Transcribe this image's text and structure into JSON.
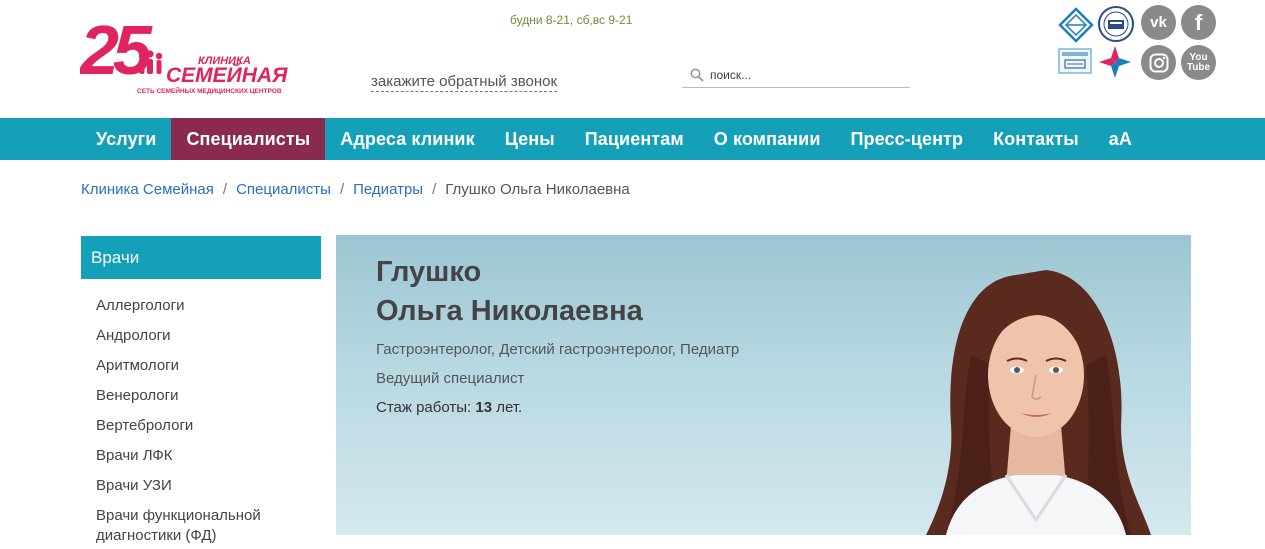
{
  "header": {
    "logo": {
      "number": "25",
      "line1": "КЛИНИКА",
      "line2": "СЕМЕЙНАЯ",
      "tagline": "СЕТЬ СЕМЕЙНЫХ МЕДИЦИНСКИХ ЦЕНТРОВ",
      "color": "#e0245e"
    },
    "hours": "будни 8-21, сб,вс 9-21",
    "callback": "закажите обратный звонок",
    "search": {
      "placeholder": "поиск..."
    },
    "badges": [
      "diamond-badge-icon",
      "seal-badge-icon",
      "certificate-icon",
      "arrows-logo-icon"
    ],
    "social": [
      "vk-icon",
      "facebook-icon",
      "instagram-icon",
      "youtube-icon"
    ],
    "social_text": {
      "vk": "vk",
      "facebook": "f",
      "youtube_top": "You",
      "youtube_bottom": "Tube"
    }
  },
  "nav": {
    "items": [
      "Услуги",
      "Специалисты",
      "Адреса клиник",
      "Цены",
      "Пациентам",
      "О компании",
      "Пресс-центр",
      "Контакты",
      "аА"
    ],
    "active": "Специалисты",
    "color": "#14a0b8",
    "active_color": "#8a2a4e"
  },
  "breadcrumb": {
    "items": [
      "Клиника Семейная",
      "Специалисты",
      "Педиатры"
    ],
    "current": "Глушко Ольга Николаевна",
    "sep": "/"
  },
  "sidebar": {
    "title": "Врачи",
    "items": [
      "Аллергологи",
      "Андрологи",
      "Аритмологи",
      "Венерологи",
      "Вертебрологи",
      "Врачи ЛФК",
      "Врачи УЗИ",
      "Врачи функциональной диагностики (ФД)"
    ]
  },
  "doctor": {
    "last_name": "Глушко",
    "first_names": "Ольга Николаевна",
    "specialties": "Гастроэнтеролог, Детский гастроэнтеролог, Педиатр",
    "position": "Ведущий специалист",
    "experience_label": "Стаж работы:",
    "experience_value": "13",
    "experience_unit": "лет."
  }
}
